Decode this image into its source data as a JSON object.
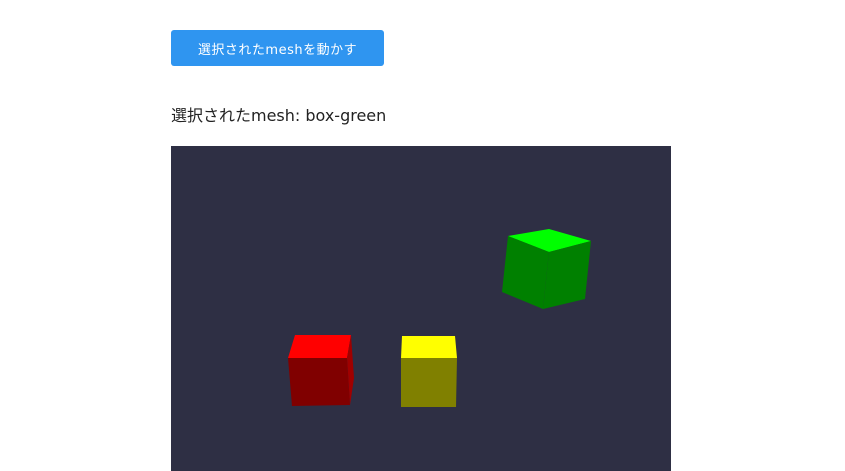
{
  "toolbar": {
    "move_button_label": "選択されたmeshを動かす"
  },
  "status": {
    "selected_mesh_text": "選択されたmesh: box-green"
  },
  "scene": {
    "background_color": "#2e2f44",
    "meshes": [
      {
        "name": "box-red",
        "top_color": "#ff0000",
        "front_color": "#800000",
        "side_color": "#a00000"
      },
      {
        "name": "box-yellow",
        "top_color": "#ffff00",
        "front_color": "#808000",
        "side_color": "#a0a000"
      },
      {
        "name": "box-green",
        "top_color": "#00ff00",
        "front_color": "#008000",
        "side_color": "#00a000"
      }
    ]
  }
}
